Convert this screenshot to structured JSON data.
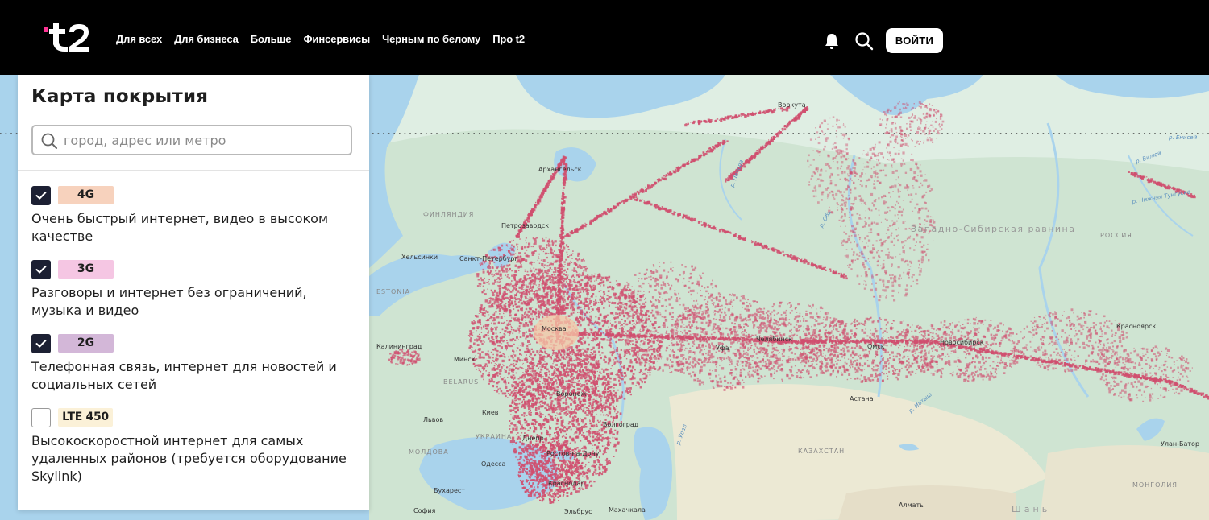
{
  "header": {
    "logo_text": "t2",
    "nav": [
      "Для всех",
      "Для бизнеса",
      "Больше",
      "Финсервисы",
      "Черным по белому",
      "Про t2"
    ],
    "login_label": "ВОЙТИ"
  },
  "panel": {
    "title": "Карта покрытия",
    "search_placeholder": "город, адрес или метро",
    "search_value": "",
    "layers": [
      {
        "badge": "4G",
        "color": "#f7d2bd",
        "checked": true,
        "desc": "Очень быстрый интернет, видео в высоком качестве"
      },
      {
        "badge": "3G",
        "color": "#f5c6e3",
        "checked": true,
        "desc": "Разговоры и интернет без ограничений, музыка и видео"
      },
      {
        "badge": "2G",
        "color": "#d3b7d8",
        "checked": true,
        "desc": "Телефонная связь, интернет для новостей и социальных сетей"
      },
      {
        "badge": "LTE 450",
        "color": "#fbf1d8",
        "checked": false,
        "desc": "Высокоскоростной интернет для самых удаленных районов (требуется оборудование Skylink)"
      }
    ]
  },
  "map": {
    "colors": {
      "coverage": "#d04f6f",
      "water": "#a9d3ec",
      "land": "#cfe4d2",
      "steppe": "#ece9d4"
    },
    "labels": {
      "countries": [
        "ФИНЛЯНДИЯ",
        "ESTONIA",
        "BELARUS",
        "УКРАИНА",
        "МОЛДОВА",
        "КАЗАХСТАН",
        "МОНГОЛИЯ",
        "РОССИЯ",
        "Западно-Сибирская равнина"
      ],
      "cities": [
        "Воркута",
        "Архангельск",
        "Петрозаводск",
        "Хельсинки",
        "Санкт-Петербург",
        "Москва",
        "Калининград",
        "Минск",
        "Воронеж",
        "Львов",
        "Киев",
        "Днепр",
        "Ростов-на-Дону",
        "Одесса",
        "Краснодар",
        "Бухарест",
        "София",
        "Уфа",
        "Челябинск",
        "Омск",
        "Новосибирск",
        "Красноярск",
        "Астана",
        "Алматы",
        "Улан-Батор",
        "Махачкала",
        "Эльбрус",
        "Волгоград"
      ],
      "rivers": [
        "р. Печора",
        "р. Обь",
        "р. Урал",
        "р. Иртыш",
        "р. Вилюй",
        "р. Нижняя Тунгуска",
        "р. Енисей"
      ],
      "misc": [
        "Шань"
      ]
    }
  }
}
